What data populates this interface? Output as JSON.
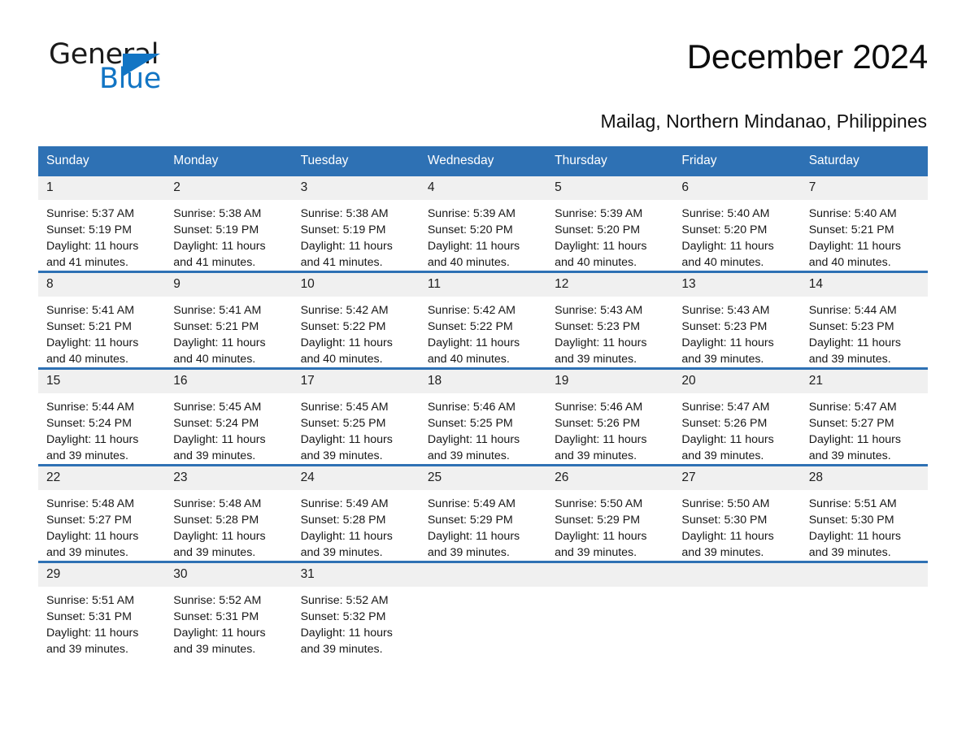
{
  "logo": {
    "word_one": "General",
    "word_two": "Blue",
    "triangle_icon": "triangle-icon"
  },
  "header": {
    "title": "December 2024",
    "subtitle": "Mailag, Northern Mindanao, Philippines"
  },
  "colors": {
    "header_blue": "#2e71b4",
    "date_strip_gray": "#f0f0f0",
    "logo_blue": "#1275c4",
    "text": "#171717"
  },
  "calendar": {
    "weekday_headers": [
      "Sunday",
      "Monday",
      "Tuesday",
      "Wednesday",
      "Thursday",
      "Friday",
      "Saturday"
    ],
    "weeks": [
      [
        {
          "day": "1",
          "sunrise": "Sunrise: 5:37 AM",
          "sunset": "Sunset: 5:19 PM",
          "daylight": "Daylight: 11 hours and 41 minutes."
        },
        {
          "day": "2",
          "sunrise": "Sunrise: 5:38 AM",
          "sunset": "Sunset: 5:19 PM",
          "daylight": "Daylight: 11 hours and 41 minutes."
        },
        {
          "day": "3",
          "sunrise": "Sunrise: 5:38 AM",
          "sunset": "Sunset: 5:19 PM",
          "daylight": "Daylight: 11 hours and 41 minutes."
        },
        {
          "day": "4",
          "sunrise": "Sunrise: 5:39 AM",
          "sunset": "Sunset: 5:20 PM",
          "daylight": "Daylight: 11 hours and 40 minutes."
        },
        {
          "day": "5",
          "sunrise": "Sunrise: 5:39 AM",
          "sunset": "Sunset: 5:20 PM",
          "daylight": "Daylight: 11 hours and 40 minutes."
        },
        {
          "day": "6",
          "sunrise": "Sunrise: 5:40 AM",
          "sunset": "Sunset: 5:20 PM",
          "daylight": "Daylight: 11 hours and 40 minutes."
        },
        {
          "day": "7",
          "sunrise": "Sunrise: 5:40 AM",
          "sunset": "Sunset: 5:21 PM",
          "daylight": "Daylight: 11 hours and 40 minutes."
        }
      ],
      [
        {
          "day": "8",
          "sunrise": "Sunrise: 5:41 AM",
          "sunset": "Sunset: 5:21 PM",
          "daylight": "Daylight: 11 hours and 40 minutes."
        },
        {
          "day": "9",
          "sunrise": "Sunrise: 5:41 AM",
          "sunset": "Sunset: 5:21 PM",
          "daylight": "Daylight: 11 hours and 40 minutes."
        },
        {
          "day": "10",
          "sunrise": "Sunrise: 5:42 AM",
          "sunset": "Sunset: 5:22 PM",
          "daylight": "Daylight: 11 hours and 40 minutes."
        },
        {
          "day": "11",
          "sunrise": "Sunrise: 5:42 AM",
          "sunset": "Sunset: 5:22 PM",
          "daylight": "Daylight: 11 hours and 40 minutes."
        },
        {
          "day": "12",
          "sunrise": "Sunrise: 5:43 AM",
          "sunset": "Sunset: 5:23 PM",
          "daylight": "Daylight: 11 hours and 39 minutes."
        },
        {
          "day": "13",
          "sunrise": "Sunrise: 5:43 AM",
          "sunset": "Sunset: 5:23 PM",
          "daylight": "Daylight: 11 hours and 39 minutes."
        },
        {
          "day": "14",
          "sunrise": "Sunrise: 5:44 AM",
          "sunset": "Sunset: 5:23 PM",
          "daylight": "Daylight: 11 hours and 39 minutes."
        }
      ],
      [
        {
          "day": "15",
          "sunrise": "Sunrise: 5:44 AM",
          "sunset": "Sunset: 5:24 PM",
          "daylight": "Daylight: 11 hours and 39 minutes."
        },
        {
          "day": "16",
          "sunrise": "Sunrise: 5:45 AM",
          "sunset": "Sunset: 5:24 PM",
          "daylight": "Daylight: 11 hours and 39 minutes."
        },
        {
          "day": "17",
          "sunrise": "Sunrise: 5:45 AM",
          "sunset": "Sunset: 5:25 PM",
          "daylight": "Daylight: 11 hours and 39 minutes."
        },
        {
          "day": "18",
          "sunrise": "Sunrise: 5:46 AM",
          "sunset": "Sunset: 5:25 PM",
          "daylight": "Daylight: 11 hours and 39 minutes."
        },
        {
          "day": "19",
          "sunrise": "Sunrise: 5:46 AM",
          "sunset": "Sunset: 5:26 PM",
          "daylight": "Daylight: 11 hours and 39 minutes."
        },
        {
          "day": "20",
          "sunrise": "Sunrise: 5:47 AM",
          "sunset": "Sunset: 5:26 PM",
          "daylight": "Daylight: 11 hours and 39 minutes."
        },
        {
          "day": "21",
          "sunrise": "Sunrise: 5:47 AM",
          "sunset": "Sunset: 5:27 PM",
          "daylight": "Daylight: 11 hours and 39 minutes."
        }
      ],
      [
        {
          "day": "22",
          "sunrise": "Sunrise: 5:48 AM",
          "sunset": "Sunset: 5:27 PM",
          "daylight": "Daylight: 11 hours and 39 minutes."
        },
        {
          "day": "23",
          "sunrise": "Sunrise: 5:48 AM",
          "sunset": "Sunset: 5:28 PM",
          "daylight": "Daylight: 11 hours and 39 minutes."
        },
        {
          "day": "24",
          "sunrise": "Sunrise: 5:49 AM",
          "sunset": "Sunset: 5:28 PM",
          "daylight": "Daylight: 11 hours and 39 minutes."
        },
        {
          "day": "25",
          "sunrise": "Sunrise: 5:49 AM",
          "sunset": "Sunset: 5:29 PM",
          "daylight": "Daylight: 11 hours and 39 minutes."
        },
        {
          "day": "26",
          "sunrise": "Sunrise: 5:50 AM",
          "sunset": "Sunset: 5:29 PM",
          "daylight": "Daylight: 11 hours and 39 minutes."
        },
        {
          "day": "27",
          "sunrise": "Sunrise: 5:50 AM",
          "sunset": "Sunset: 5:30 PM",
          "daylight": "Daylight: 11 hours and 39 minutes."
        },
        {
          "day": "28",
          "sunrise": "Sunrise: 5:51 AM",
          "sunset": "Sunset: 5:30 PM",
          "daylight": "Daylight: 11 hours and 39 minutes."
        }
      ],
      [
        {
          "day": "29",
          "sunrise": "Sunrise: 5:51 AM",
          "sunset": "Sunset: 5:31 PM",
          "daylight": "Daylight: 11 hours and 39 minutes."
        },
        {
          "day": "30",
          "sunrise": "Sunrise: 5:52 AM",
          "sunset": "Sunset: 5:31 PM",
          "daylight": "Daylight: 11 hours and 39 minutes."
        },
        {
          "day": "31",
          "sunrise": "Sunrise: 5:52 AM",
          "sunset": "Sunset: 5:32 PM",
          "daylight": "Daylight: 11 hours and 39 minutes."
        },
        {
          "day": "",
          "sunrise": "",
          "sunset": "",
          "daylight": ""
        },
        {
          "day": "",
          "sunrise": "",
          "sunset": "",
          "daylight": ""
        },
        {
          "day": "",
          "sunrise": "",
          "sunset": "",
          "daylight": ""
        },
        {
          "day": "",
          "sunrise": "",
          "sunset": "",
          "daylight": ""
        }
      ]
    ]
  }
}
